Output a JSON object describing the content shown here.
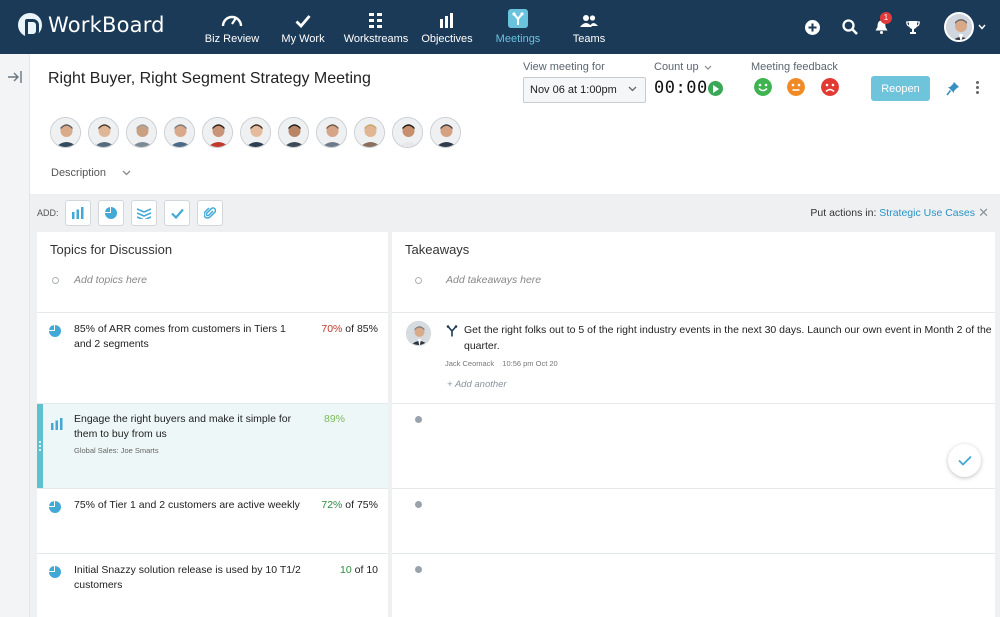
{
  "app": {
    "name": "WorkBoard"
  },
  "nav": {
    "items": [
      {
        "label": "Biz Review",
        "icon": "speedometer-icon"
      },
      {
        "label": "My Work",
        "icon": "checkmark-icon"
      },
      {
        "label": "Workstreams",
        "icon": "grid-icon"
      },
      {
        "label": "Objectives",
        "icon": "bar-chart-icon"
      },
      {
        "label": "Meetings",
        "icon": "meetings-icon",
        "active": true
      },
      {
        "label": "Teams",
        "icon": "people-icon"
      }
    ],
    "notification_count": "1"
  },
  "meeting": {
    "title": "Right Buyer, Right Segment Strategy Meeting",
    "attendee_count": 11,
    "description_label": "Description",
    "view_label": "View meeting for",
    "view_value": "Nov 06 at 1:00pm",
    "count_label": "Count up",
    "timer": "00:00",
    "feedback_label": "Meeting feedback",
    "reopen_label": "Reopen"
  },
  "addbar": {
    "label": "ADD:",
    "buttons": [
      "bar-chart-icon",
      "pie-chart-icon",
      "layers-icon",
      "checkmark-icon",
      "paperclip-icon"
    ],
    "put_actions_label": "Put actions in:",
    "put_actions_target": "Strategic Use Cases"
  },
  "topics": {
    "title": "Topics for Discussion",
    "placeholder": "Add topics here",
    "items": [
      {
        "text": "85% of ARR comes from customers in Tiers 1 and 2 segments",
        "icon": "pie-chart-icon",
        "value": "70%",
        "value_color": "#c0392b",
        "target": "of 85%"
      },
      {
        "text": "Engage the right buyers and make it simple for them to buy from us",
        "icon": "bar-chart-icon",
        "value": "89%",
        "value_color": "#7dbb5c",
        "target": "",
        "sub": "Global Sales: Joe Smarts"
      },
      {
        "text": "75% of Tier 1 and 2 customers are active weekly",
        "icon": "pie-chart-icon",
        "value": "72%",
        "value_color": "#2e8b3e",
        "target": "of 75%"
      },
      {
        "text": "Initial Snazzy solution release is used by 10 T1/2 customers",
        "icon": "pie-chart-icon",
        "value": "10",
        "value_color": "#2e8b3e",
        "target": "of 10"
      }
    ]
  },
  "takeaways": {
    "title": "Takeaways",
    "placeholder": "Add takeaways here",
    "items": [
      {
        "text": "Get the right folks out to 5 of the right industry events in the next 30 days. Launch our own event in Month 2 of the quarter.",
        "author": "Jack Ceomack",
        "time": "10:56 pm Oct 20",
        "add_another": "+ Add another"
      }
    ]
  },
  "colors": {
    "nav_bg": "#1b3a57",
    "accent": "#69c3dd",
    "button": "#6ec4db"
  }
}
